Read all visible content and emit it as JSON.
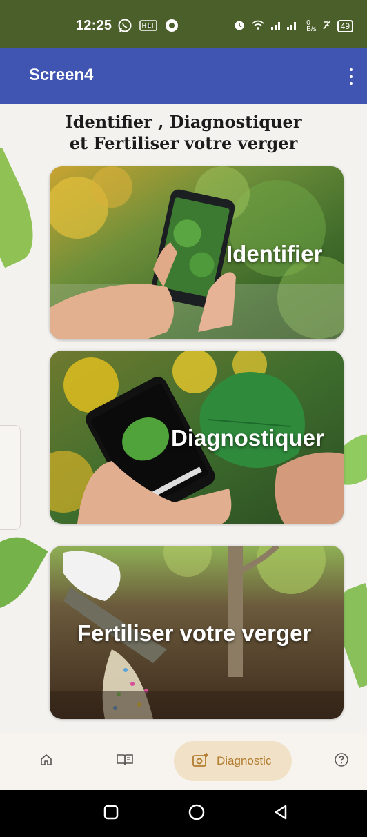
{
  "status_bar": {
    "time": "12:25",
    "battery": "49",
    "net_speed_top": "0",
    "net_speed_unit": "B/s",
    "hd_badge": "HD"
  },
  "app_bar": {
    "title": "Screen4"
  },
  "main": {
    "heading_line1": "Identifier , Diagnostiquer",
    "heading_line2": "et Fertiliser votre verger",
    "cards": [
      {
        "label": "Identifier"
      },
      {
        "label": "Diagnostiquer"
      },
      {
        "label": "Fertiliser votre verger"
      }
    ]
  },
  "bottom_nav": {
    "items": [
      {
        "icon": "home-icon"
      },
      {
        "icon": "book-icon"
      },
      {
        "icon": "camera-icon",
        "label": "Diagnostic",
        "active": true
      },
      {
        "icon": "help-icon"
      }
    ]
  },
  "colors": {
    "status_bar": "#4a5f29",
    "app_bar": "#4055b2",
    "background": "#f4f2ef",
    "active_pill": "#f1e2c7",
    "active_text": "#b17c2f"
  }
}
